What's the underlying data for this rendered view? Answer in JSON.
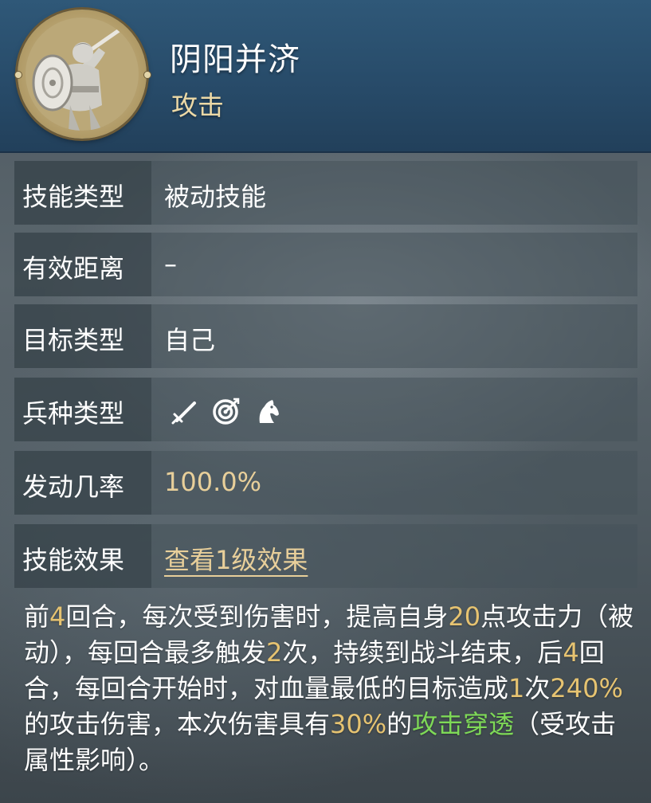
{
  "skill": {
    "name": "阴阳并济",
    "category": "攻击"
  },
  "details": {
    "skill_type": {
      "label": "技能类型",
      "value": "被动技能"
    },
    "range": {
      "label": "有效距离",
      "value": "–"
    },
    "target_type": {
      "label": "目标类型",
      "value": "自己"
    },
    "troop_type": {
      "label": "兵种类型",
      "icons": [
        "sword-icon",
        "bow-target-icon",
        "horse-head-icon"
      ]
    },
    "trigger_rate": {
      "label": "发动几率",
      "value": "100.0%"
    },
    "effect": {
      "label": "技能效果",
      "link_text": "查看1级效果"
    }
  },
  "description": {
    "segments": [
      {
        "t": "前",
        "c": ""
      },
      {
        "t": "4",
        "c": "gold"
      },
      {
        "t": "回合，每次受到伤害时，提高自身",
        "c": ""
      },
      {
        "t": "20",
        "c": "gold"
      },
      {
        "t": "点攻击力（被动），每回合最多触发",
        "c": ""
      },
      {
        "t": "2",
        "c": "gold"
      },
      {
        "t": "次，持续到战斗结束，后",
        "c": ""
      },
      {
        "t": "4",
        "c": "gold"
      },
      {
        "t": "回合，每回合开始时，对血量最低的目标造成",
        "c": ""
      },
      {
        "t": "1",
        "c": "gold"
      },
      {
        "t": "次",
        "c": ""
      },
      {
        "t": "240%",
        "c": "gold"
      },
      {
        "t": "的攻击伤害，本次伤害具有",
        "c": ""
      },
      {
        "t": "30%",
        "c": "gold"
      },
      {
        "t": "的",
        "c": ""
      },
      {
        "t": "攻击穿透",
        "c": "green"
      },
      {
        "t": "（受攻击属性影响）。",
        "c": ""
      }
    ]
  },
  "colors": {
    "header_bg": "#2f5878",
    "accent_gold": "#e6c371",
    "accent_green": "#7ed957",
    "subtitle": "#ecd9a6"
  }
}
